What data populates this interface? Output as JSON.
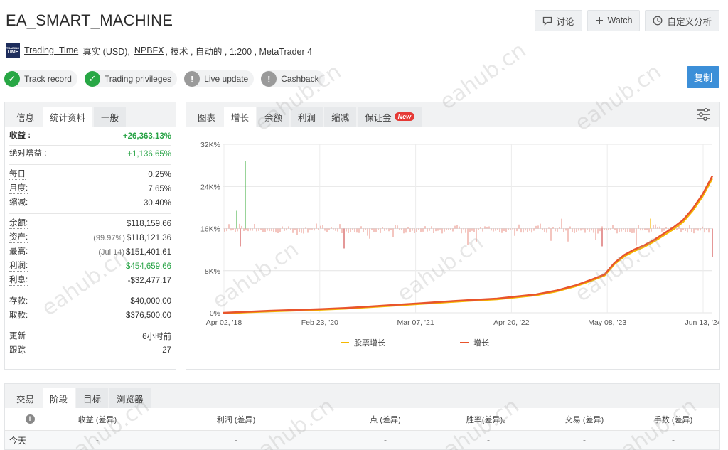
{
  "title": "EA_SMART_MACHINE",
  "actions": {
    "discuss": "讨论",
    "watch": "Watch",
    "custom": "自定义分析"
  },
  "meta": {
    "logo_top": "TRADING",
    "logo_main": "TIME",
    "account_name": "Trading_Time",
    "account_type": "真实 (USD),",
    "broker": "NPBFX",
    "details": ", 技术 , 自动的 , 1:200 , MetaTrader 4"
  },
  "badges": [
    {
      "label": "Track record",
      "status": "ok"
    },
    {
      "label": "Trading privileges",
      "status": "ok"
    },
    {
      "label": "Live update",
      "status": "warn"
    },
    {
      "label": "Cashback",
      "status": "warn"
    }
  ],
  "copy_label": "复制",
  "info_tabs": [
    "信息",
    "统计资料",
    "一般"
  ],
  "stats": {
    "gain_k": "收益 :",
    "gain_v": "+26,363.13%",
    "abs_k": "绝对增益 :",
    "abs_v": "+1,136.65%",
    "daily_k": "每日",
    "daily_v": "0.25%",
    "monthly_k": "月度:",
    "monthly_v": "7.65%",
    "dd_k": "缩减:",
    "dd_v": "30.40%",
    "balance_k": "余额:",
    "balance_v": "$118,159.66",
    "equity_k": "资产:",
    "equity_sub": "(99.97%)",
    "equity_v": "$118,121.36",
    "highest_k": "最高:",
    "highest_sub": "(Jul 14)",
    "highest_v": "$151,401.61",
    "profit_k": "利润:",
    "profit_v": "$454,659.66",
    "interest_k": "利息:",
    "interest_v": "-$32,477.17",
    "deposits_k": "存款:",
    "deposits_v": "$40,000.00",
    "withdrawals_k": "取款:",
    "withdrawals_v": "$376,500.00",
    "updated_k": "更新",
    "updated_v": "6小时前",
    "tracking_k": "跟踪",
    "tracking_v": "27"
  },
  "chart_tabs": {
    "label": "图表",
    "growth": "增长",
    "balance": "余额",
    "profit": "利润",
    "drawdown": "缩减",
    "margin": "保证金",
    "new": "New"
  },
  "chart_data": {
    "type": "line",
    "y_ticks": [
      "0%",
      "8K%",
      "16K%",
      "24K%",
      "32K%"
    ],
    "ylim": [
      0,
      32000
    ],
    "x_ticks": [
      "Apr 02, '18",
      "Feb 23, '20",
      "Mar 07, '21",
      "Apr 20, '22",
      "May 08, '23",
      "Jun 13, '24"
    ],
    "series": [
      {
        "name": "增长",
        "color": "#e8542c",
        "points": [
          [
            0,
            0
          ],
          [
            0.05,
            200
          ],
          [
            0.1,
            400
          ],
          [
            0.15,
            550
          ],
          [
            0.2,
            700
          ],
          [
            0.25,
            900
          ],
          [
            0.3,
            1200
          ],
          [
            0.35,
            1500
          ],
          [
            0.4,
            1800
          ],
          [
            0.45,
            2100
          ],
          [
            0.5,
            2400
          ],
          [
            0.52,
            2500
          ],
          [
            0.56,
            2700
          ],
          [
            0.6,
            3100
          ],
          [
            0.64,
            3500
          ],
          [
            0.68,
            4200
          ],
          [
            0.72,
            5200
          ],
          [
            0.75,
            6200
          ],
          [
            0.78,
            7300
          ],
          [
            0.8,
            9500
          ],
          [
            0.82,
            11000
          ],
          [
            0.84,
            12000
          ],
          [
            0.86,
            12800
          ],
          [
            0.88,
            13800
          ],
          [
            0.9,
            15000
          ],
          [
            0.92,
            16200
          ],
          [
            0.94,
            17600
          ],
          [
            0.96,
            19800
          ],
          [
            0.98,
            22500
          ],
          [
            1.0,
            26000
          ]
        ]
      },
      {
        "name": "股票增长",
        "color": "#f5b800"
      }
    ]
  },
  "bottom_tabs": [
    "交易",
    "阶段",
    "目标",
    "浏览器"
  ],
  "table": {
    "headers": [
      "收益 (差异)",
      "利润 (差异)",
      "点 (差异)",
      "胜率(差异)。",
      "交易 (差异)",
      "手数 (差异)"
    ],
    "row_label": "今天",
    "row_values": [
      "-",
      "-",
      "-",
      "-",
      "-",
      "-"
    ]
  },
  "watermark": "eahub.cn"
}
